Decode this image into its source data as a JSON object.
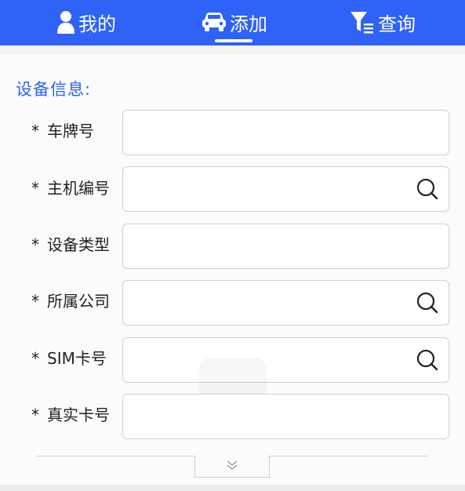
{
  "nav": {
    "tabs": [
      {
        "label": "我的",
        "icon": "user-icon"
      },
      {
        "label": "添加",
        "icon": "car-icon",
        "active": true
      },
      {
        "label": "查询",
        "icon": "filter-icon"
      }
    ],
    "accent": "#2f62f7"
  },
  "section": {
    "title": "设备信息:"
  },
  "form": {
    "required_mark": "*",
    "fields": [
      {
        "label": "车牌号",
        "value": "",
        "has_search": false
      },
      {
        "label": "主机编号",
        "value": "",
        "has_search": true
      },
      {
        "label": "设备类型",
        "value": "",
        "has_search": false
      },
      {
        "label": "所属公司",
        "value": "",
        "has_search": true
      },
      {
        "label": "SIM卡号",
        "value": "",
        "has_search": true
      },
      {
        "label": "真实卡号",
        "value": "",
        "has_search": false
      }
    ]
  },
  "expand": {
    "icon": "chevron-double-down-icon"
  }
}
